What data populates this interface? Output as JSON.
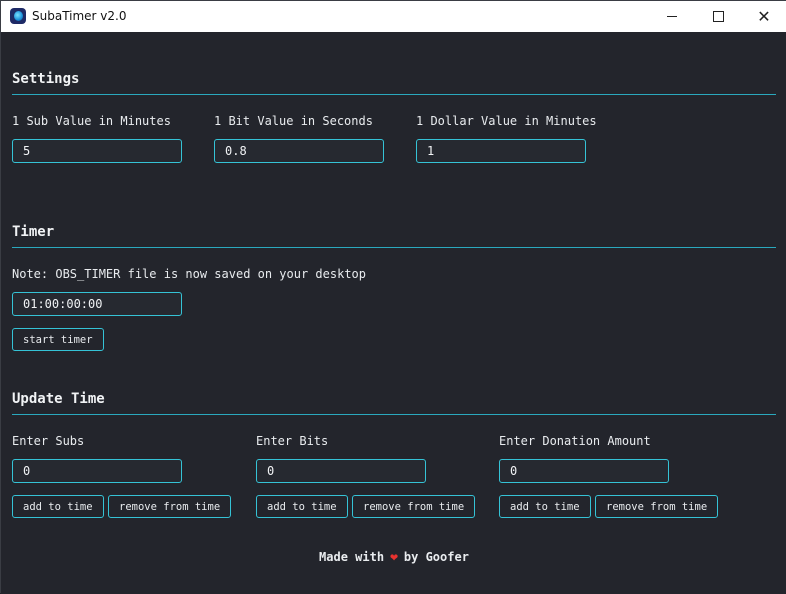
{
  "window": {
    "title": "SubaTimer v2.0"
  },
  "settings": {
    "title": "Settings",
    "sub_label": "1 Sub Value in Minutes",
    "sub_value": "5",
    "bit_label": "1 Bit Value in Seconds",
    "bit_value": "0.8",
    "dollar_label": "1 Dollar Value in Minutes",
    "dollar_value": "1"
  },
  "timer": {
    "title": "Timer",
    "note": "Note: OBS_TIMER file is now saved on your desktop",
    "value": "01:00:00:00",
    "start_label": "start timer"
  },
  "update": {
    "title": "Update Time",
    "subs_label": "Enter Subs",
    "subs_value": "0",
    "bits_label": "Enter Bits",
    "bits_value": "0",
    "donation_label": "Enter Donation Amount",
    "donation_value": "0",
    "add_label": "add to time",
    "remove_label": "remove from time"
  },
  "footer": {
    "made_with": "Made with",
    "heart_icon": "heart-icon",
    "by": "by Goofer"
  },
  "colors": {
    "accent": "#35c3d6",
    "background": "#23252c",
    "heart": "#e8322f"
  }
}
